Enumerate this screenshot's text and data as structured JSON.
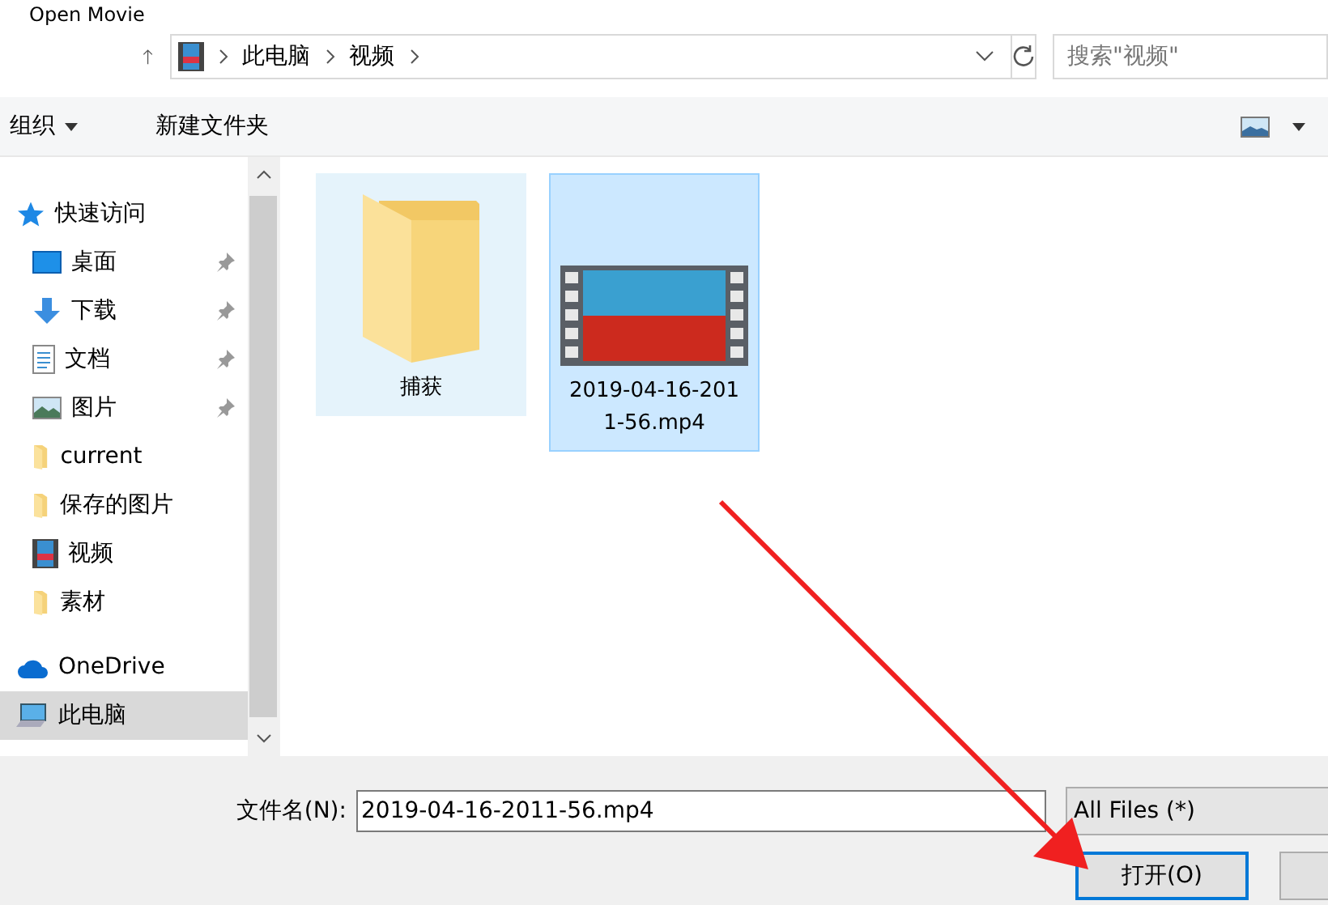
{
  "window": {
    "title": "Open Movie"
  },
  "address_bar": {
    "path": [
      "此电脑",
      "视频"
    ]
  },
  "search": {
    "placeholder": "搜索\"视频\""
  },
  "toolbar": {
    "organize": "组织",
    "new_folder": "新建文件夹"
  },
  "sidebar": {
    "items": [
      {
        "kind": "quick",
        "label": "快速访问",
        "selected": false,
        "children": [
          {
            "kind": "desktop",
            "label": "桌面",
            "pinned": true,
            "selected": false
          },
          {
            "kind": "downloads",
            "label": "下载",
            "pinned": true,
            "selected": false
          },
          {
            "kind": "documents",
            "label": "文档",
            "pinned": true,
            "selected": false
          },
          {
            "kind": "pictures",
            "label": "图片",
            "pinned": true,
            "selected": false
          },
          {
            "kind": "folder",
            "label": "current",
            "pinned": false,
            "selected": false
          },
          {
            "kind": "folder",
            "label": "保存的图片",
            "pinned": false,
            "selected": false
          },
          {
            "kind": "videos",
            "label": "视频",
            "pinned": false,
            "selected": false
          },
          {
            "kind": "folder",
            "label": "素材",
            "pinned": false,
            "selected": false
          }
        ]
      },
      {
        "kind": "cloud",
        "label": "OneDrive",
        "selected": false
      },
      {
        "kind": "pc",
        "label": "此电脑",
        "selected": true
      }
    ]
  },
  "files": [
    {
      "kind": "folder",
      "name": "捕获",
      "hovered": true,
      "selected": false
    },
    {
      "kind": "video",
      "name": "2019-04-16-2011-56.mp4",
      "hovered": false,
      "selected": true
    }
  ],
  "footer": {
    "filename_label": "文件名(N):",
    "filename": "2019-04-16-2011-56.mp4",
    "filter": "All Files  (*)",
    "open_button": "打开(O)"
  }
}
